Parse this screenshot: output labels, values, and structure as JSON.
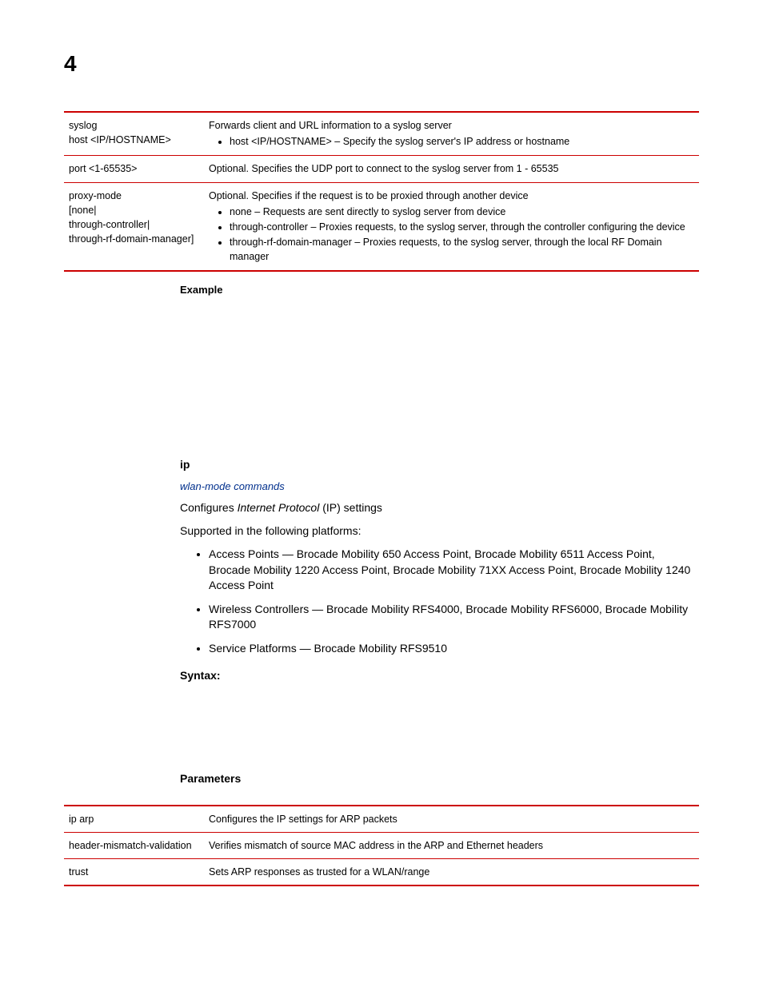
{
  "chapterNumber": "4",
  "table1": {
    "rows": [
      {
        "param_lines": [
          "syslog",
          "host <IP/HOSTNAME>"
        ],
        "desc_lead": "Forwards client and URL information to a syslog server",
        "bullets": [
          "host <IP/HOSTNAME> – Specify the syslog server's IP address or hostname"
        ]
      },
      {
        "param_lines": [
          "port <1-65535>"
        ],
        "desc_plain": "Optional. Specifies the UDP port to connect to the syslog server from 1 - 65535"
      },
      {
        "param_lines": [
          "proxy-mode",
          "[none|",
          "through-controller|",
          "through-rf-domain-manager]"
        ],
        "desc_lead": "Optional. Specifies if the request is to be proxied through another device",
        "bullets": [
          "none – Requests are sent directly to syslog server from device",
          "through-controller – Proxies requests, to the syslog server, through the controller configuring the device",
          "through-rf-domain-manager – Proxies requests, to the syslog server, through the local RF Domain manager"
        ]
      }
    ]
  },
  "exampleHeading": "Example",
  "ipSection": {
    "heading": "ip",
    "link": "wlan-mode commands",
    "desc_pre": "Configures ",
    "desc_ital": "Internet Protocol",
    "desc_post": " (IP) settings",
    "supported": "Supported in the following platforms:",
    "platforms": [
      "Access Points — Brocade Mobility 650 Access Point, Brocade Mobility 6511 Access Point, Brocade Mobility 1220 Access Point, Brocade Mobility 71XX Access Point, Brocade Mobility 1240 Access Point",
      "Wireless Controllers — Brocade Mobility RFS4000, Brocade Mobility RFS6000, Brocade Mobility RFS7000",
      "Service Platforms — Brocade Mobility RFS9510"
    ],
    "syntaxHeading": "Syntax:",
    "parametersHeading": "Parameters"
  },
  "table2": {
    "rows": [
      {
        "param": "ip arp",
        "desc": "Configures the IP settings for ARP packets"
      },
      {
        "param": "header-mismatch-validation",
        "desc": "Verifies mismatch of source MAC address in the ARP and Ethernet headers"
      },
      {
        "param": "trust",
        "desc": "Sets ARP responses as trusted for a WLAN/range"
      }
    ]
  }
}
